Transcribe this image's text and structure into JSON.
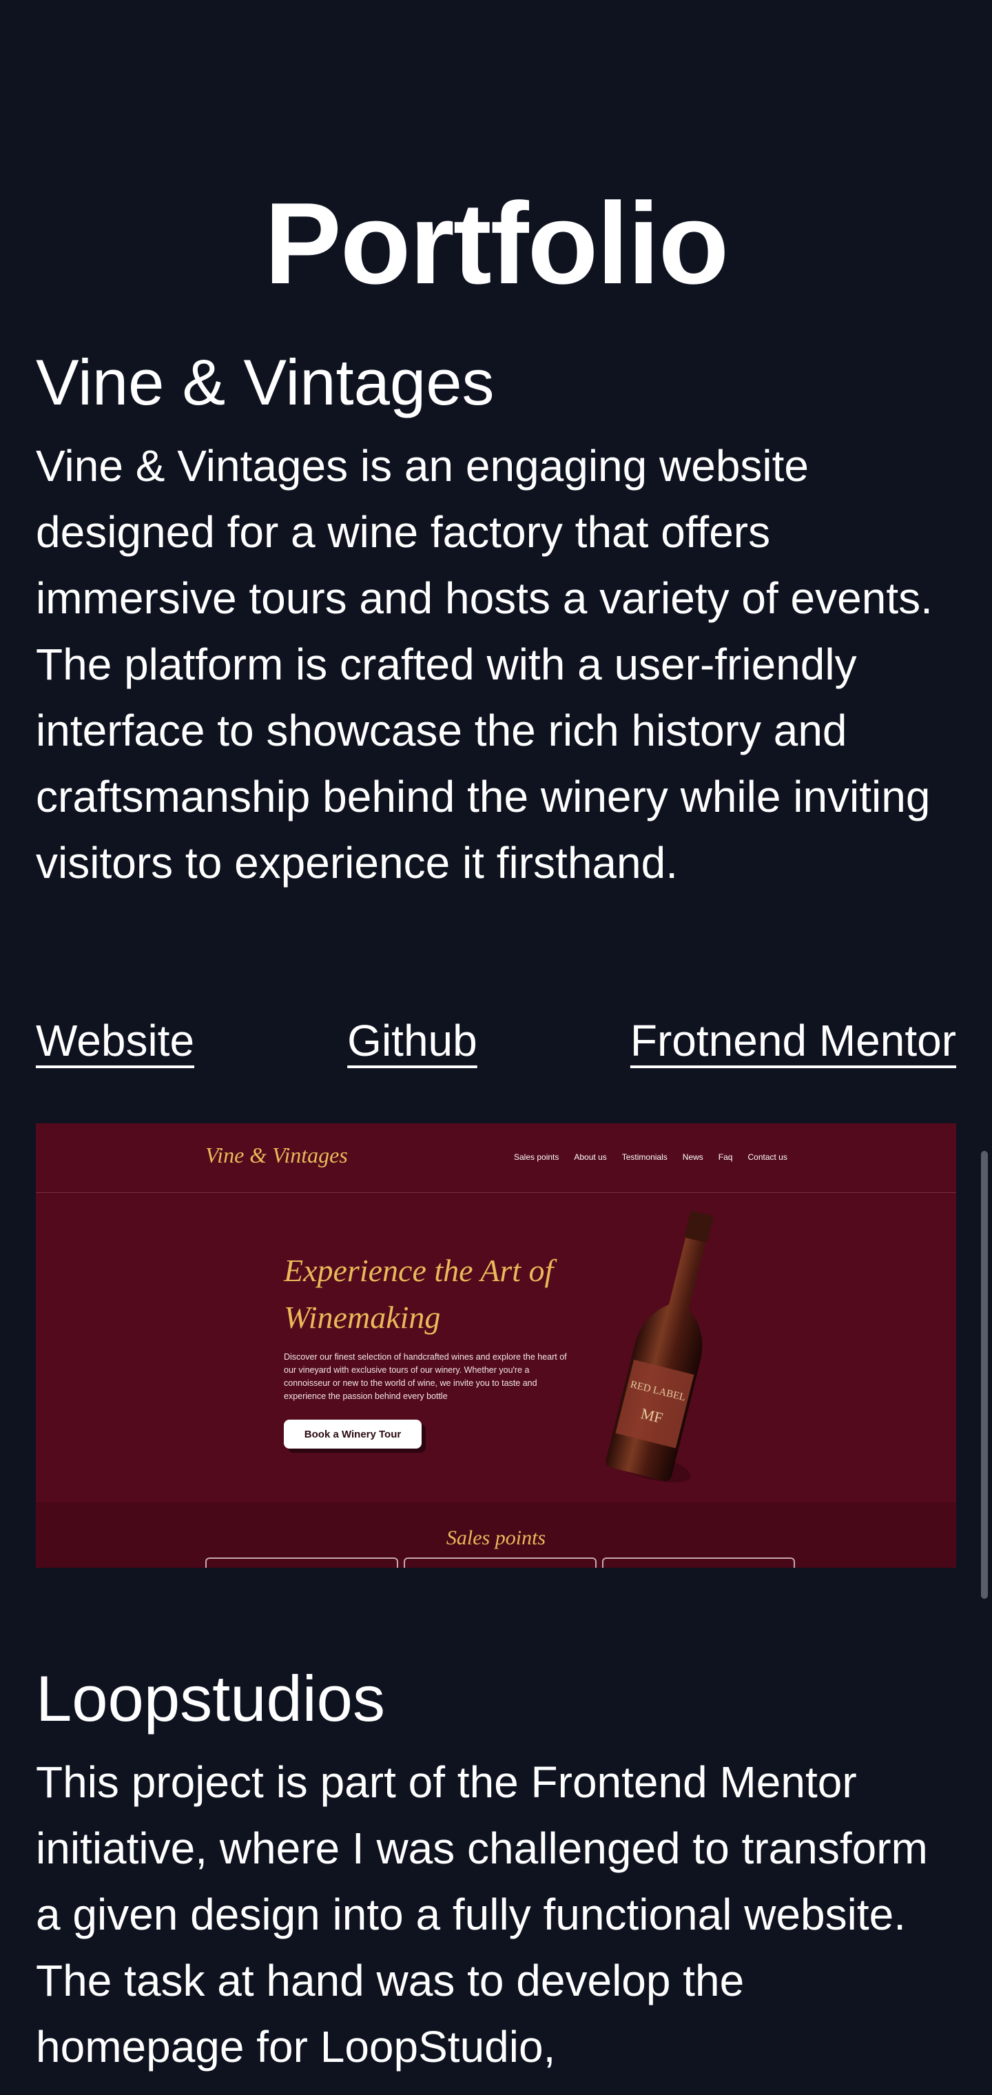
{
  "page": {
    "title": "Portfolio"
  },
  "projects": [
    {
      "title": "Vine & Vintages",
      "description": "Vine & Vintages is an engaging website designed for a wine factory that offers immersive tours and hosts a variety of events. The platform is crafted with a user-friendly interface to showcase the rich history and craftsmanship behind the winery while inviting visitors to experience it firsthand.",
      "links": [
        "Website",
        "Github",
        "Frotnend Mentor"
      ],
      "preview": {
        "logo": "Vine & Vintages",
        "menu": [
          "Sales points",
          "About us",
          "Testimonials",
          "News",
          "Faq",
          "Contact us"
        ],
        "hero_title": "Experience the Art of Winemaking",
        "hero_text": "Discover our finest selection of handcrafted wines and explore the heart of our vineyard with exclusive tours of our winery. Whether you're a connoisseur or new to the world of wine, we invite you to taste and experience the passion behind every bottle",
        "cta": "Book a Winery Tour",
        "bottle_label": "RED LABEL",
        "bottle_monogram": "MF",
        "sales_title": "Sales points"
      }
    },
    {
      "title": "Loopstudios",
      "description": "This project is part of the Frontend Mentor initiative, where I was challenged to transform a given design into a fully functional website. The task at hand was to develop the homepage for LoopStudio,"
    }
  ],
  "colors": {
    "background": "#0f1320",
    "text": "#ffffff",
    "wine": "#520a1c",
    "gold": "#e9b95a"
  }
}
